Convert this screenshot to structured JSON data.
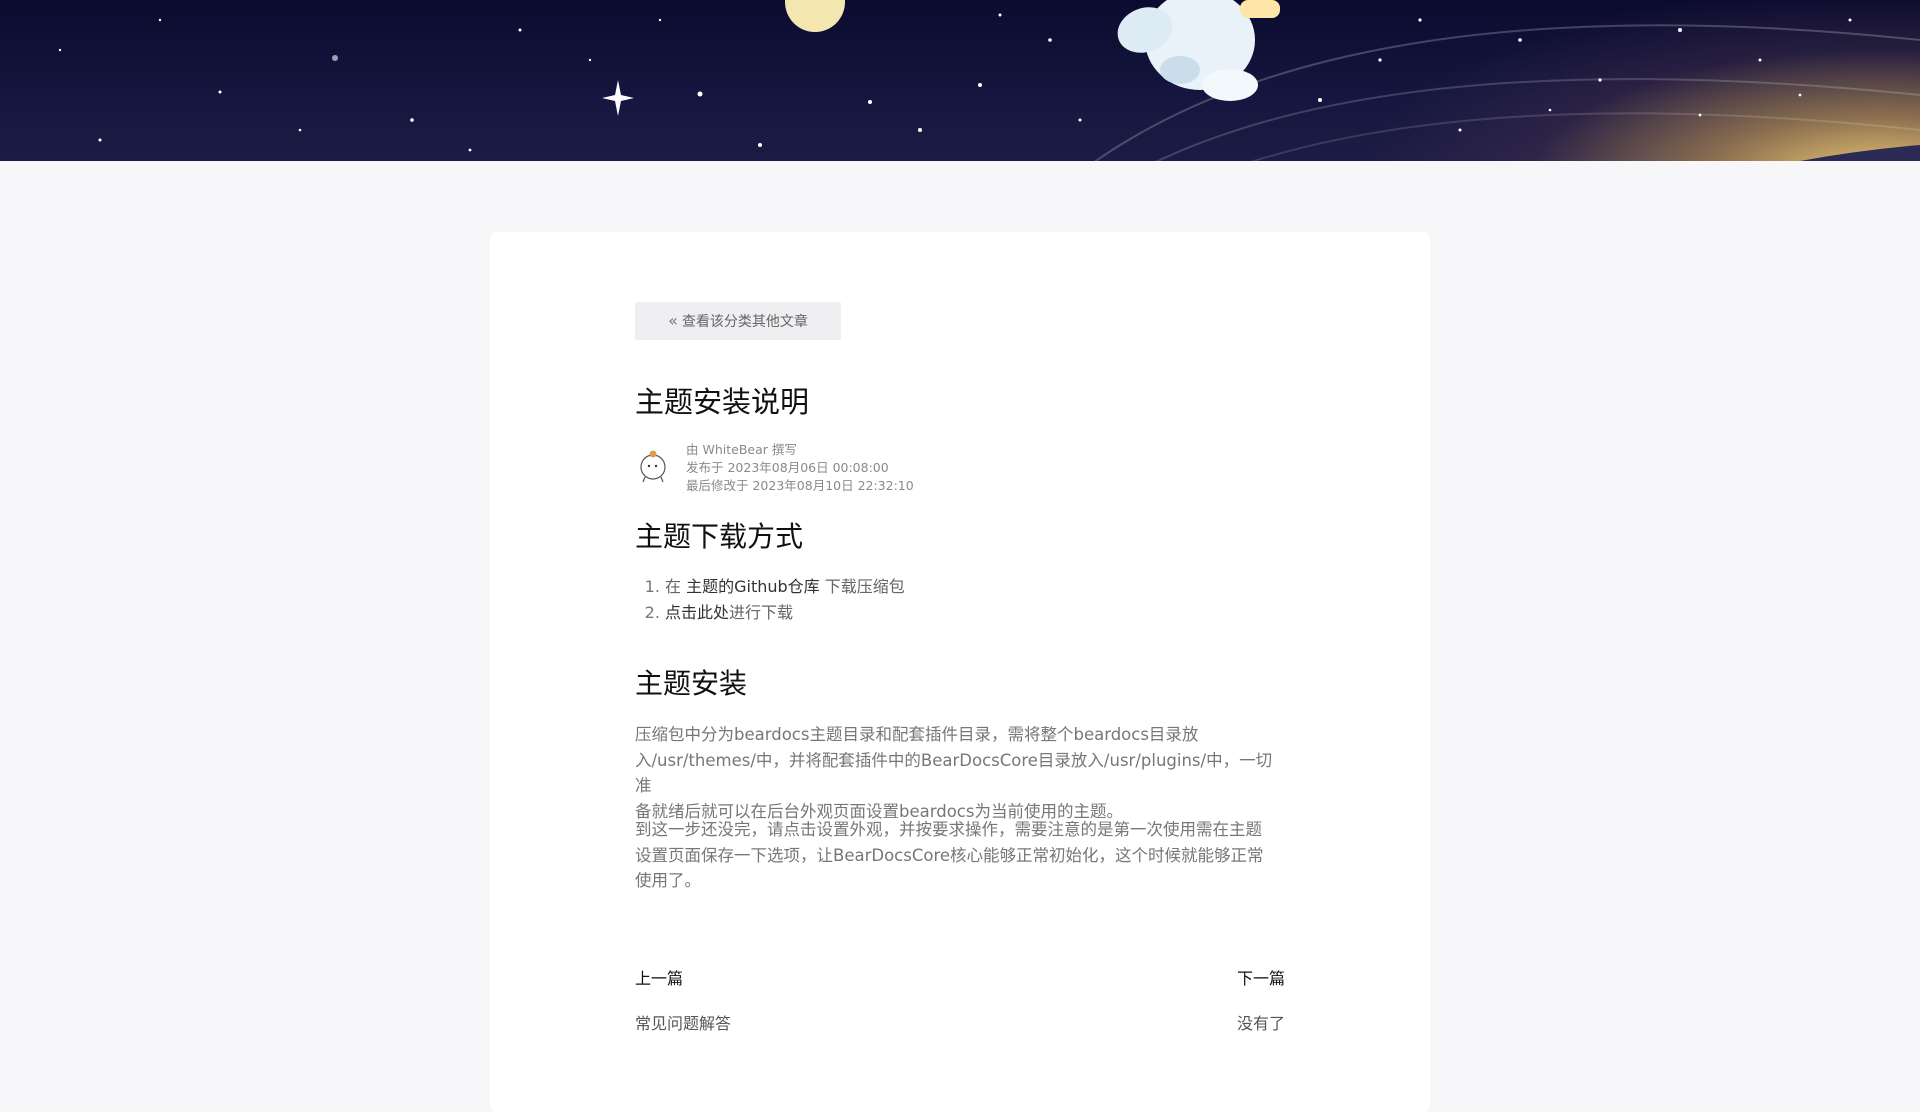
{
  "article_nav": {
    "back_label": "查看该分类其他文章"
  },
  "article": {
    "title": "主题安装说明",
    "author_line": "由 WhiteBear 撰写",
    "published_line": "发布于 2023年08月06日 00:08:00",
    "modified_line": "最后修改于 2023年08月10日 22:32:10"
  },
  "download_section": {
    "heading": "主题下载方式",
    "item1_prefix": "在 ",
    "item1_link": "主题的Github仓库",
    "item1_suffix": " 下载压缩包",
    "item2_link": "点击此处",
    "item2_suffix": "进行下载"
  },
  "install_section": {
    "heading": "主题安装",
    "paragraph1_lines": [
      "压缩包中分为beardocs主题目录和配套插件目录，需将整个beardocs目录放",
      "入/usr/themes/中，并将配套插件中的BearDocsCore目录放入/usr/plugins/中，一切准",
      "备就绪后就可以在后台外观页面设置beardocs为当前使用的主题。"
    ],
    "paragraph2_lines": [
      "到这一步还没完，请点击设置外观，并按要求操作，需要注意的是第一次使用需在主题",
      "设置页面保存一下选项，让BearDocsCore核心能够正常初始化，这个时候就能够正常",
      "使用了。"
    ]
  },
  "post_nav": {
    "prev_label": "上一篇",
    "prev_title": "常见问题解答",
    "next_label": "下一篇",
    "next_title": "没有了"
  }
}
